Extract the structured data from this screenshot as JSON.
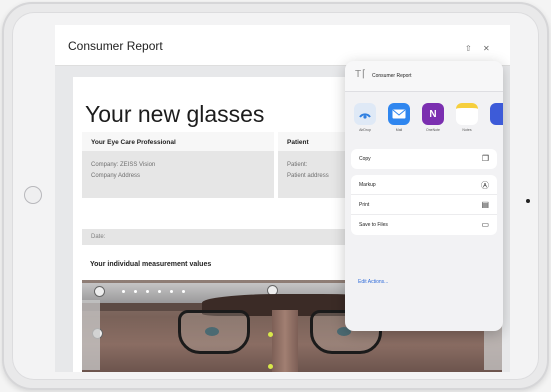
{
  "report": {
    "window_title": "Consumer Report",
    "headline": "Your new glasses",
    "eye_care": {
      "heading": "Your Eye Care Professional",
      "company": "Company: ZEISS Vision",
      "address": "Company Address"
    },
    "patient": {
      "heading": "Patient",
      "name": "Patient:",
      "address": "Patient address"
    },
    "date_label": "Date:",
    "measurement_heading": "Your individual measurement values"
  },
  "share_sheet": {
    "doc_title": "Consumer Report",
    "apps": [
      {
        "label": "AirDrop",
        "icon": "airdrop-icon",
        "color": "#2f7fe0"
      },
      {
        "label": "Mail",
        "icon": "mail-icon",
        "color": "#2f86ef"
      },
      {
        "label": "OneNote",
        "icon": "onenote-icon",
        "color": "#7b2fb0"
      },
      {
        "label": "Notes",
        "icon": "notes-icon",
        "color": "#f6cf3d"
      }
    ],
    "actions_group1": [
      {
        "label": "Copy",
        "icon": "copy-icon"
      }
    ],
    "actions_group2": [
      {
        "label": "Markup",
        "icon": "markup-icon"
      },
      {
        "label": "Print",
        "icon": "print-icon"
      },
      {
        "label": "Save to Files",
        "icon": "folder-icon"
      }
    ],
    "edit_actions": "Edit Actions..."
  },
  "colors": {
    "accent": "#2f6bd9",
    "device": "#e9e9ea",
    "screen_bg": "#e7e8ea"
  }
}
